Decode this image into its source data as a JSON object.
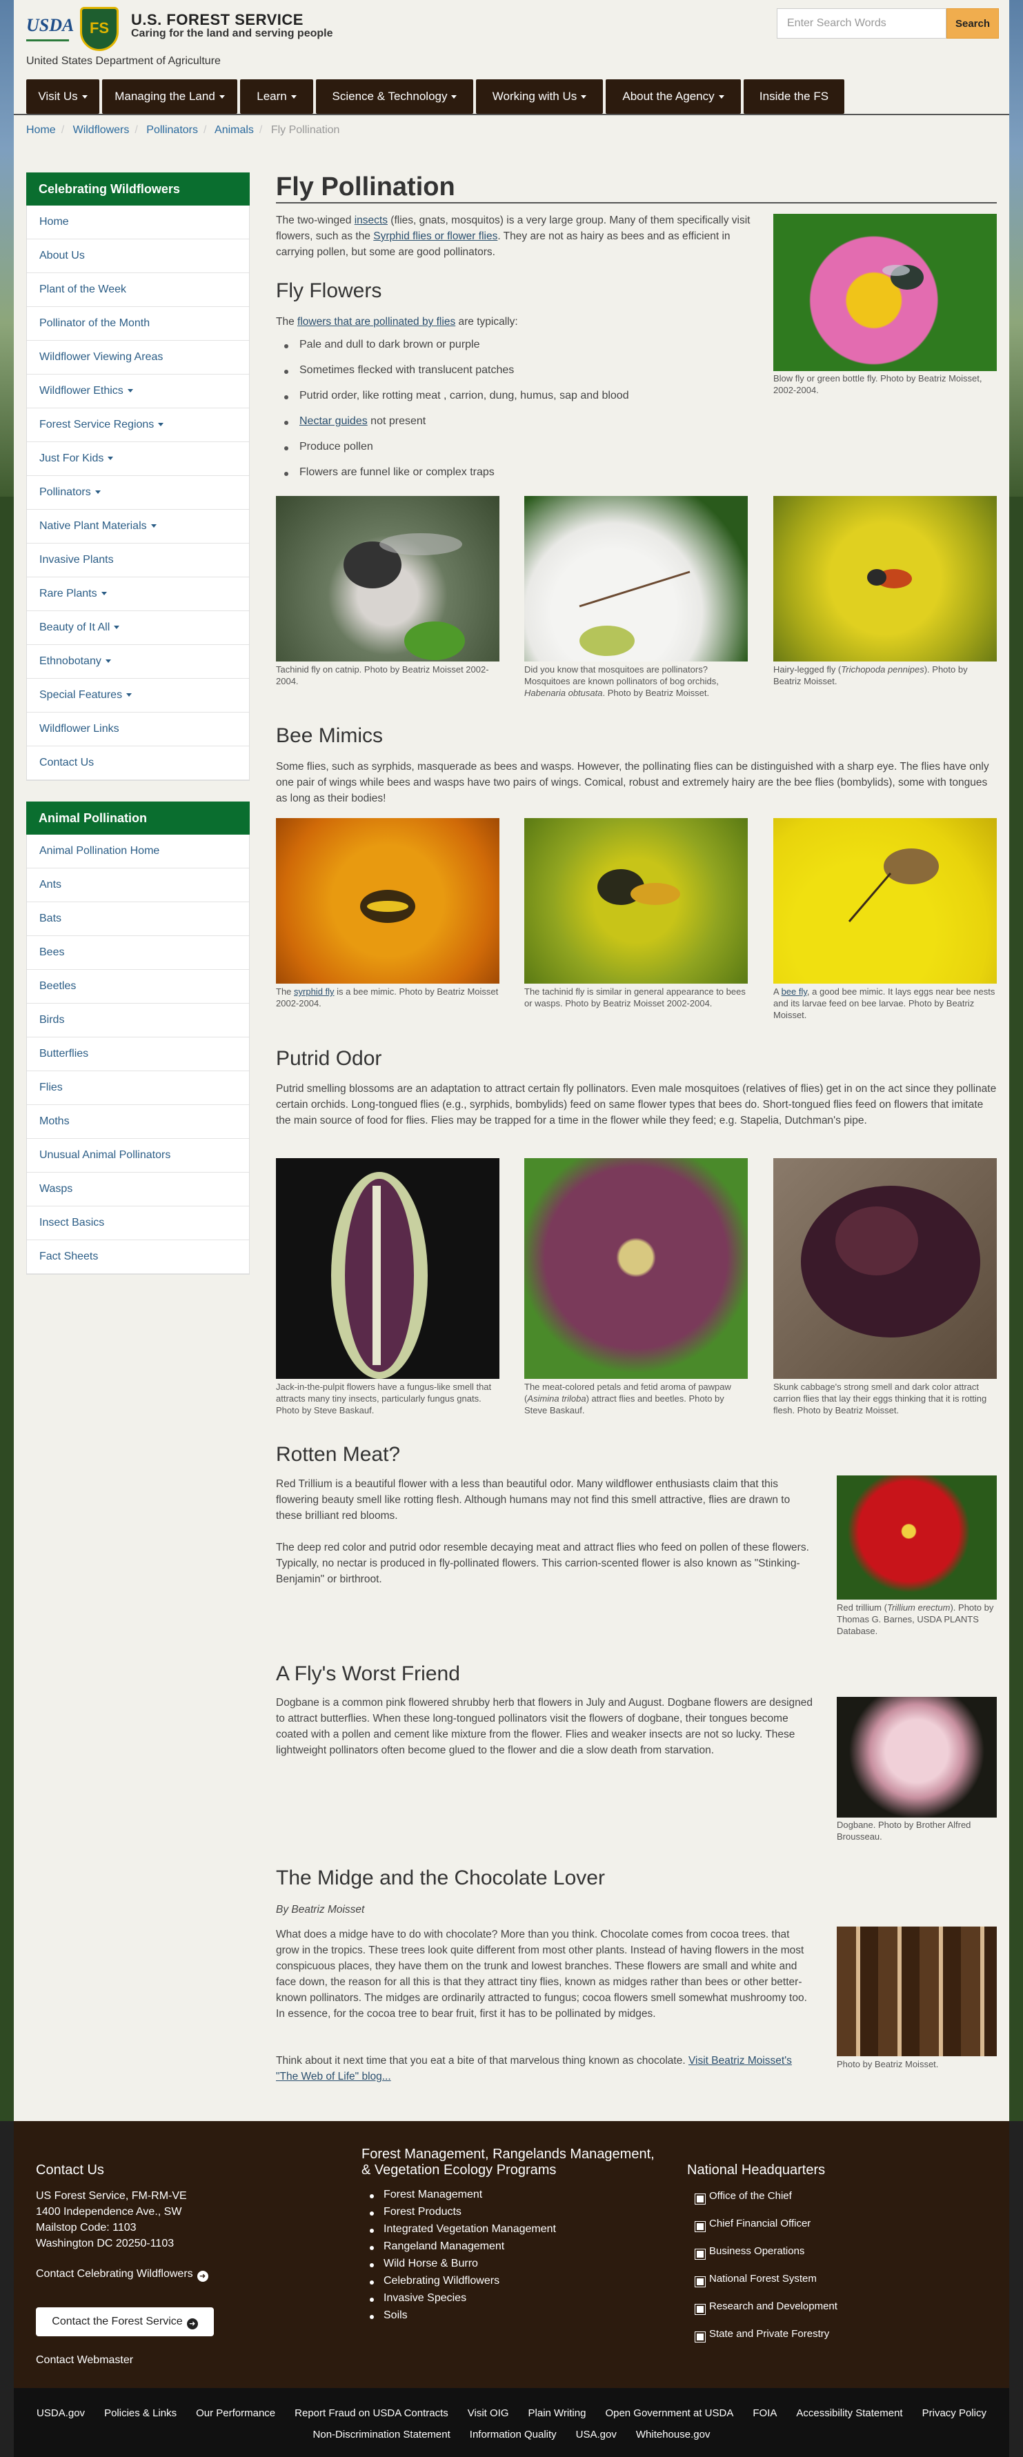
{
  "header": {
    "usda_logo": "USDA",
    "fs_shield": "FS",
    "agency": "U.S. FOREST SERVICE",
    "tagline": "Caring for the land and serving people",
    "department": "United States Department of Agriculture",
    "search_placeholder": "Enter Search Words",
    "search_button": "Search"
  },
  "nav": [
    {
      "label": "Visit Us",
      "dropdown": true
    },
    {
      "label": "Managing the Land",
      "dropdown": true
    },
    {
      "label": "Learn",
      "dropdown": true
    },
    {
      "label": "Science & Technology",
      "dropdown": true
    },
    {
      "label": "Working with Us",
      "dropdown": true
    },
    {
      "label": "About the Agency",
      "dropdown": true
    },
    {
      "label": "Inside the FS",
      "dropdown": false
    }
  ],
  "breadcrumb": [
    "Home",
    "Wildflowers",
    "Pollinators",
    "Animals",
    "Fly Pollination"
  ],
  "sidebar1": {
    "title": "Celebrating Wildflowers",
    "items": [
      {
        "label": "Home",
        "dd": false
      },
      {
        "label": "About Us",
        "dd": false
      },
      {
        "label": "Plant of the Week",
        "dd": false
      },
      {
        "label": "Pollinator of the Month",
        "dd": false
      },
      {
        "label": "Wildflower Viewing Areas",
        "dd": false
      },
      {
        "label": "Wildflower Ethics",
        "dd": true
      },
      {
        "label": "Forest Service Regions",
        "dd": true
      },
      {
        "label": "Just For Kids",
        "dd": true
      },
      {
        "label": "Pollinators",
        "dd": true
      },
      {
        "label": "Native Plant Materials",
        "dd": true
      },
      {
        "label": "Invasive Plants",
        "dd": false
      },
      {
        "label": "Rare Plants",
        "dd": true
      },
      {
        "label": "Beauty of It All",
        "dd": true
      },
      {
        "label": "Ethnobotany",
        "dd": true
      },
      {
        "label": "Special Features",
        "dd": true
      },
      {
        "label": "Wildflower Links",
        "dd": false
      },
      {
        "label": "Contact Us",
        "dd": false
      }
    ]
  },
  "sidebar2": {
    "title": "Animal Pollination",
    "items": [
      {
        "label": "Animal Pollination Home"
      },
      {
        "label": "Ants"
      },
      {
        "label": "Bats"
      },
      {
        "label": "Bees"
      },
      {
        "label": "Beetles"
      },
      {
        "label": "Birds"
      },
      {
        "label": "Butterflies"
      },
      {
        "label": "Flies"
      },
      {
        "label": "Moths"
      },
      {
        "label": "Unusual Animal Pollinators"
      },
      {
        "label": "Wasps"
      },
      {
        "label": "Insect Basics"
      },
      {
        "label": "Fact Sheets"
      }
    ]
  },
  "main": {
    "title": "Fly Pollination",
    "intro": {
      "a": "The two-winged ",
      "link1": "insects",
      "b": " (flies, gnats, mosquitos) is a very large group. Many of them specifically visit flowers, such as the ",
      "link2": "Syrphid flies or flower flies",
      "c": ". They are not as hairy as bees and as efficient in carrying pollen, but some are good pollinators."
    },
    "intro_caption": "Blow fly or green bottle fly. Photo by Beatriz Moisset, 2002-2004.",
    "fly_flowers": {
      "heading": "Fly Flowers",
      "lead_a": "The ",
      "lead_link": "flowers that are pollinated by flies",
      "lead_b": " are typically:",
      "bullets": [
        {
          "text": "Pale and dull to dark brown or purple"
        },
        {
          "text": "Sometimes flecked with translucent patches"
        },
        {
          "text": "Putrid order, like rotting meat , carrion, dung, humus, sap and blood"
        },
        {
          "link": "Nectar guides",
          "text": " not present"
        },
        {
          "text": "Produce pollen"
        },
        {
          "text": "Flowers are funnel like or complex traps"
        }
      ],
      "captions": [
        {
          "text": "Tachinid fly on catnip. Photo by Beatriz Moisset 2002-2004."
        },
        {
          "a": "Did you know that mosquitoes are pollinators? Mosquitoes are known pollinators of bog orchids, ",
          "i": "Habenaria obtusata",
          "b": ". Photo by Beatriz Moisset."
        },
        {
          "a": "Hairy-legged fly (",
          "i": "Trichopoda pennipes",
          "b": "). Photo by Beatriz Moisset."
        }
      ]
    },
    "bee_mimics": {
      "heading": "Bee Mimics",
      "text": "Some flies, such as syrphids, masquerade as bees and wasps. However, the pollinating flies can be distinguished with a sharp eye. The flies have only one pair of wings while bees and wasps have two pairs of wings. Comical, robust and extremely hairy are the bee flies (bombylids), some with tongues as long as their bodies!",
      "captions": [
        {
          "a": "The ",
          "link": "syrphid fly",
          "b": " is a bee mimic. Photo by Beatriz Moisset 2002-2004."
        },
        {
          "a": "The tachinid fly is similar in general appearance to bees or wasps. Photo by Beatriz Moisset 2002-2004."
        },
        {
          "a": "A ",
          "link": "bee fly",
          "b": ", a good bee mimic. It lays eggs near bee nests and its larvae feed on bee larvae. Photo by Beatriz Moisset."
        }
      ]
    },
    "putrid": {
      "heading": "Putrid Odor",
      "text": "Putrid smelling blossoms are an adaptation to attract certain fly pollinators. Even male mosquitoes (relatives of flies) get in on the act since they pollinate certain orchids. Long-tongued flies (e.g., syrphids, bombylids) feed on same flower types that bees do. Short-tongued flies feed on flowers that imitate the main source of food for flies. Flies may be trapped for a time in the flower while they feed; e.g. Stapelia, Dutchman's pipe.",
      "captions": [
        {
          "a": "Jack-in-the-pulpit flowers have a fungus-like smell that attracts many tiny insects, particularly fungus gnats. Photo by Steve Baskauf."
        },
        {
          "a": "The meat-colored petals and fetid aroma of pawpaw (",
          "i": "Asimina triloba",
          "b": ") attract flies and beetles. Photo by Steve Baskauf."
        },
        {
          "a": "Skunk cabbage's strong smell and dark color attract carrion flies that lay their eggs thinking that it is rotting flesh. Photo by Beatriz Moisset."
        }
      ]
    },
    "rotten": {
      "heading": "Rotten Meat?",
      "p1": "Red Trillium is a beautiful flower with a less than beautiful odor. Many wildflower enthusiasts claim that this flowering beauty smell like rotting flesh. Although humans may not find this smell attractive, flies are drawn to these brilliant red blooms.",
      "p2": "The deep red color and putrid odor resemble decaying meat and attract flies who feed on pollen of these flowers. Typically, no nectar is produced in fly-pollinated flowers. This carrion-scented flower is also known as \"Stinking-Benjamin\" or birthroot.",
      "caption_a": "Red trillium (",
      "caption_i": "Trillium erectum",
      "caption_b": "). Photo by Thomas G. Barnes, USDA PLANTS Database."
    },
    "worst": {
      "heading": "A Fly's Worst Friend",
      "text": "Dogbane is a common pink flowered shrubby herb that flowers in July and August. Dogbane flowers are designed to attract butterflies. When these long-tongued pollinators visit the flowers of dogbane, their tongues become coated with a pollen and cement like mixture from the flower. Flies and weaker insects are not so lucky. These lightweight pollinators often become glued to the flower and die a slow death from starvation.",
      "caption": "Dogbane. Photo by Brother Alfred Brousseau."
    },
    "midge": {
      "heading": "The Midge and the Chocolate Lover",
      "byline": "By Beatriz Moisset",
      "text": "What does a midge have to do with chocolate? More than you think. Chocolate comes from cocoa trees. that grow in the tropics. These trees look quite different from most other plants. Instead of having flowers in the most conspicuous places, they have them on the trunk and lowest branches. These flowers are small and white and face down, the reason for all this is that they attract tiny flies, known as midges rather than bees or other better-known pollinators. The midges are ordinarily attracted to fungus; cocoa flowers smell somewhat mushroomy too. In essence, for the cocoa tree to bear fruit, first it has to be pollinated by midges.",
      "think": "Think about it next time that you eat a bite of that marvelous thing known as chocolate. ",
      "think_link": "Visit Beatriz Moisset's \"The Web of Life\" blog...",
      "caption": "Photo by Beatriz Moisset."
    }
  },
  "footer": {
    "contact_title": "Contact Us",
    "address": [
      "US Forest Service, FM-RM-VE",
      "1400 Independence Ave., SW",
      "Mailstop Code: 1103",
      "Washington DC 20250-1103"
    ],
    "contact_cw": "Contact Celebrating Wildflowers",
    "contact_fs": "Contact the Forest Service",
    "webmaster": "Contact Webmaster",
    "fm_title_1": "Forest Management, Rangelands Management,",
    "fm_title_2": "& Vegetation Ecology Programs",
    "fm_links": [
      "Forest Management",
      "Forest Products",
      "Integrated Vegetation Management",
      "Rangeland Management",
      "Wild Horse & Burro",
      "Celebrating Wildflowers",
      "Invasive Species",
      "Soils"
    ],
    "hq_title": "National Headquarters",
    "hq_links": [
      "Office of the Chief",
      "Chief Financial Officer",
      "Business Operations",
      "National Forest System",
      "Research and Development",
      "State and Private Forestry"
    ],
    "bottom_row1": [
      "USDA.gov",
      "Policies & Links",
      "Our Performance",
      "Report Fraud on USDA Contracts",
      "Visit OIG",
      "Plain Writing",
      "Open Government at USDA",
      "FOIA",
      "Accessibility Statement",
      "Privacy Policy"
    ],
    "bottom_row2": [
      "Non-Discrimination Statement",
      "Information Quality",
      "USA.gov",
      "Whitehouse.gov"
    ]
  },
  "colors": {
    "nav_bg": "#2c1b0e",
    "sidebar_head": "#0a6e2f",
    "search_btn": "#f0ad4e",
    "link": "#2b5d86"
  }
}
